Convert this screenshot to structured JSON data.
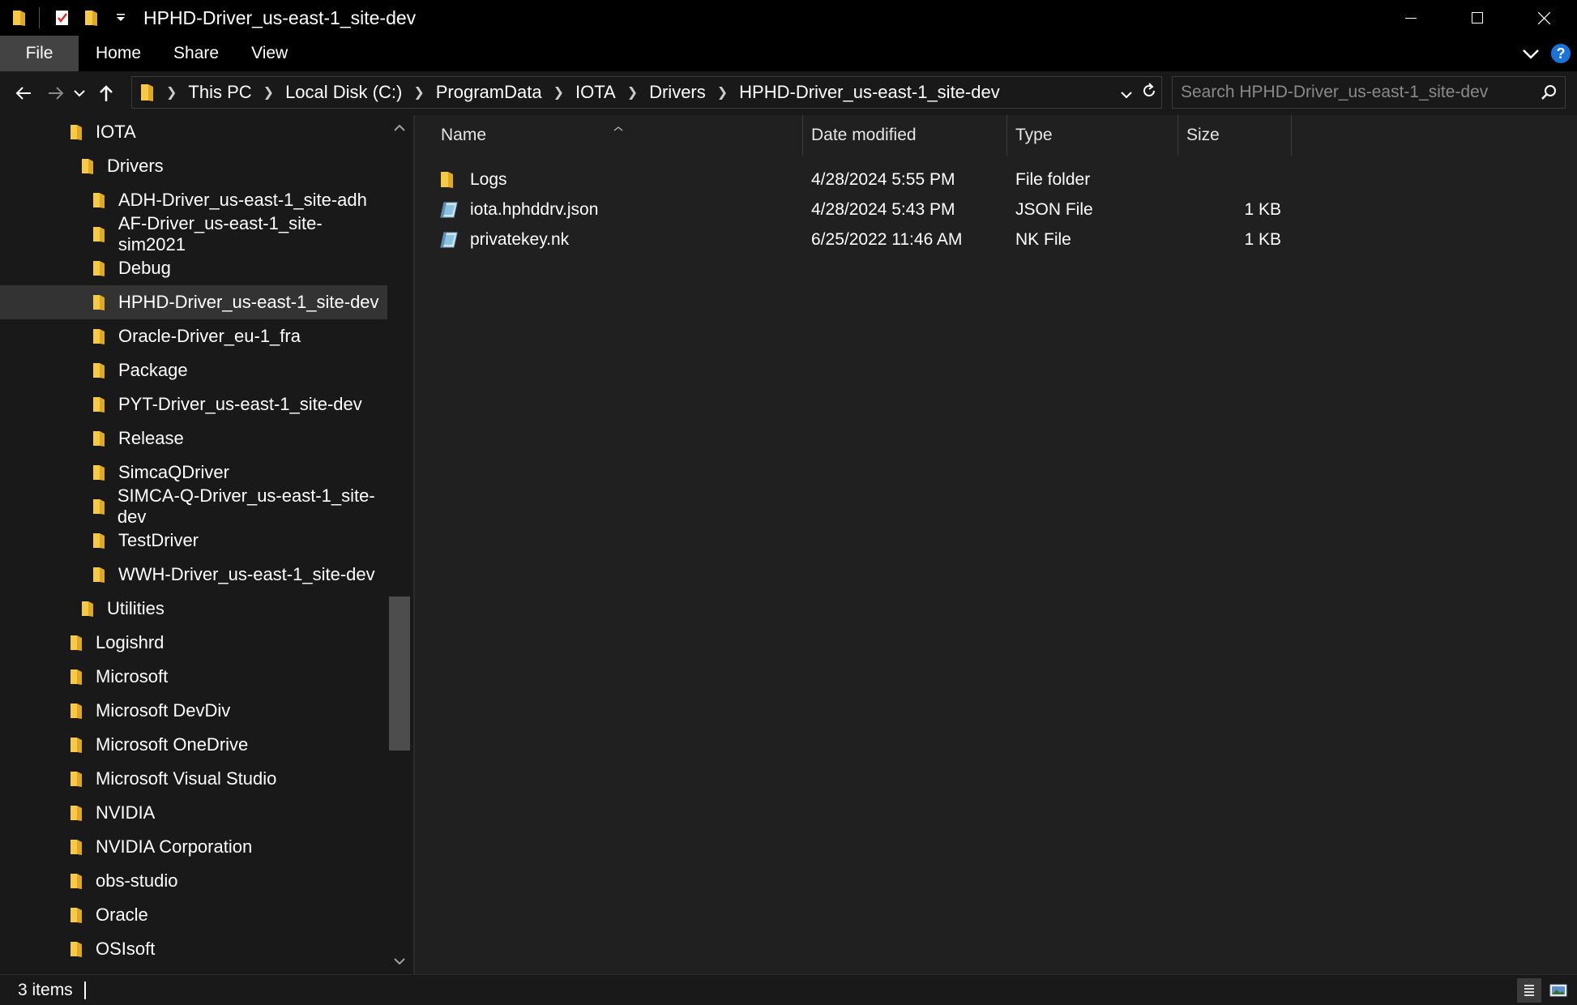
{
  "window": {
    "title": "HPHD-Driver_us-east-1_site-dev"
  },
  "ribbon": {
    "tabs": [
      "File",
      "Home",
      "Share",
      "View"
    ]
  },
  "address": {
    "crumbs": [
      "This PC",
      "Local Disk (C:)",
      "ProgramData",
      "IOTA",
      "Drivers",
      "HPHD-Driver_us-east-1_site-dev"
    ]
  },
  "search": {
    "placeholder": "Search HPHD-Driver_us-east-1_site-dev"
  },
  "navpane": {
    "items": [
      {
        "label": "IOTA",
        "indent": 1,
        "selected": false
      },
      {
        "label": "Drivers",
        "indent": 2,
        "selected": false
      },
      {
        "label": "ADH-Driver_us-east-1_site-adh",
        "indent": 3,
        "selected": false
      },
      {
        "label": "AF-Driver_us-east-1_site-sim2021",
        "indent": 3,
        "selected": false
      },
      {
        "label": "Debug",
        "indent": 3,
        "selected": false
      },
      {
        "label": "HPHD-Driver_us-east-1_site-dev",
        "indent": 3,
        "selected": true
      },
      {
        "label": "Oracle-Driver_eu-1_fra",
        "indent": 3,
        "selected": false
      },
      {
        "label": "Package",
        "indent": 3,
        "selected": false
      },
      {
        "label": "PYT-Driver_us-east-1_site-dev",
        "indent": 3,
        "selected": false
      },
      {
        "label": "Release",
        "indent": 3,
        "selected": false
      },
      {
        "label": "SimcaQDriver",
        "indent": 3,
        "selected": false
      },
      {
        "label": "SIMCA-Q-Driver_us-east-1_site-dev",
        "indent": 3,
        "selected": false
      },
      {
        "label": "TestDriver",
        "indent": 3,
        "selected": false
      },
      {
        "label": "WWH-Driver_us-east-1_site-dev",
        "indent": 3,
        "selected": false
      },
      {
        "label": "Utilities",
        "indent": 2,
        "selected": false
      },
      {
        "label": "Logishrd",
        "indent": 1,
        "selected": false
      },
      {
        "label": "Microsoft",
        "indent": 1,
        "selected": false
      },
      {
        "label": "Microsoft DevDiv",
        "indent": 1,
        "selected": false
      },
      {
        "label": "Microsoft OneDrive",
        "indent": 1,
        "selected": false
      },
      {
        "label": "Microsoft Visual Studio",
        "indent": 1,
        "selected": false
      },
      {
        "label": "NVIDIA",
        "indent": 1,
        "selected": false
      },
      {
        "label": "NVIDIA Corporation",
        "indent": 1,
        "selected": false
      },
      {
        "label": "obs-studio",
        "indent": 1,
        "selected": false
      },
      {
        "label": "Oracle",
        "indent": 1,
        "selected": false
      },
      {
        "label": "OSIsoft",
        "indent": 1,
        "selected": false
      }
    ]
  },
  "content": {
    "columns": {
      "name": "Name",
      "date": "Date modified",
      "type": "Type",
      "size": "Size"
    },
    "files": [
      {
        "name": "Logs",
        "date": "4/28/2024 5:55 PM",
        "type": "File folder",
        "size": "",
        "icon": "folder-icon"
      },
      {
        "name": "iota.hphddrv.json",
        "date": "4/28/2024 5:43 PM",
        "type": "JSON File",
        "size": "1 KB",
        "icon": "file-icon"
      },
      {
        "name": "privatekey.nk",
        "date": "6/25/2022 11:46 AM",
        "type": "NK File",
        "size": "1 KB",
        "icon": "file-icon"
      }
    ]
  },
  "status": {
    "count": "3 items"
  },
  "colors": {
    "folder": "#f7c948",
    "background": "#191919",
    "content_bg": "#202020",
    "selected": "#333333",
    "help": "#1a73d9"
  }
}
